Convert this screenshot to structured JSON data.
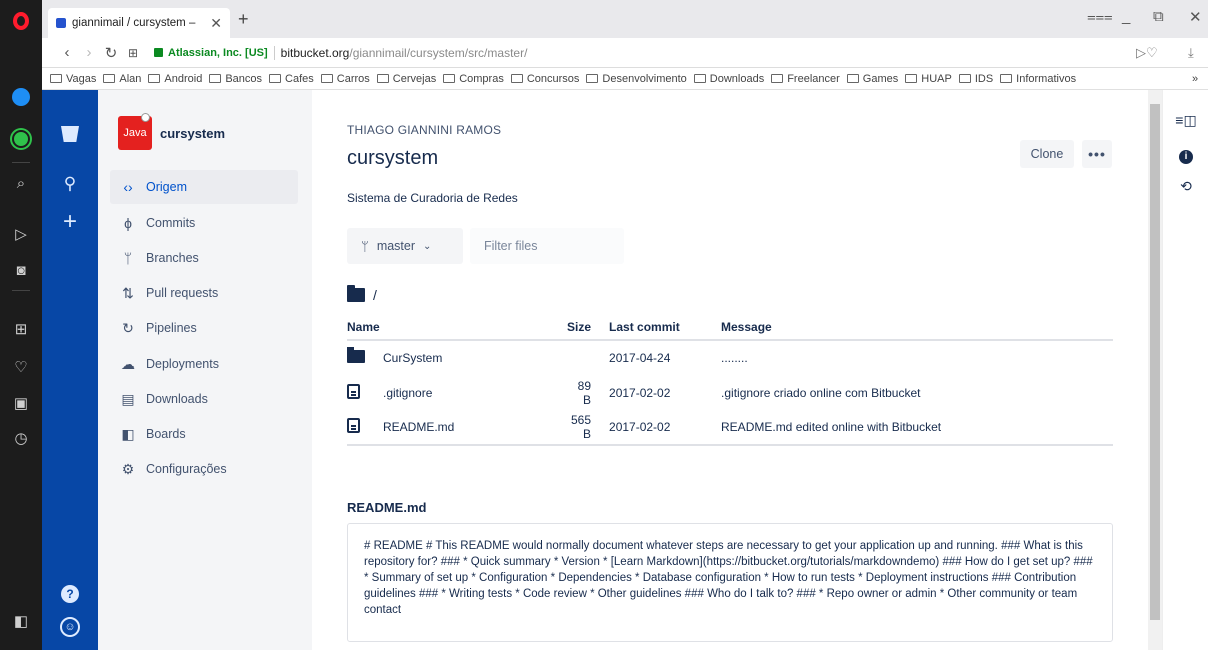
{
  "browser": {
    "tab_title": "giannimail / cursystem –",
    "tab_close": "✕",
    "new_tab": "+",
    "url_cert": "Atlassian, Inc. [US]",
    "url_host": "bitbucket.org",
    "url_path": "/giannimail/cursystem/src/master/",
    "bookmarks": [
      "Vagas",
      "Alan",
      "Android",
      "Bancos",
      "Cafes",
      "Carros",
      "Cervejas",
      "Compras",
      "Concursos",
      "Desenvolvimento",
      "Downloads",
      "Freelancer",
      "Games",
      "HUAP",
      "IDS",
      "Informativos"
    ],
    "bookmarks_more": "»"
  },
  "repo": {
    "logo_text": "Java",
    "name": "cursystem",
    "owner": "THIAGO GIANNINI RAMOS",
    "title": "cursystem",
    "description": "Sistema de Curadoria de Redes",
    "clone_label": "Clone",
    "more_label": "•••"
  },
  "nav": {
    "items": [
      {
        "label": "Origem",
        "icon": "‹›"
      },
      {
        "label": "Commits",
        "icon": "ϕ"
      },
      {
        "label": "Branches",
        "icon": "ᛘ"
      },
      {
        "label": "Pull requests",
        "icon": "⇅"
      },
      {
        "label": "Pipelines",
        "icon": "↻"
      },
      {
        "label": "Deployments",
        "icon": "☁"
      },
      {
        "label": "Downloads",
        "icon": "▤"
      },
      {
        "label": "Boards",
        "icon": "◧"
      },
      {
        "label": "Configurações",
        "icon": "⚙"
      }
    ]
  },
  "source": {
    "branch": "master",
    "filter_placeholder": "Filter files",
    "path": "/",
    "columns": {
      "name": "Name",
      "size": "Size",
      "last_commit": "Last commit",
      "message": "Message"
    },
    "rows": [
      {
        "type": "folder",
        "name": "CurSystem",
        "size": "",
        "date": "2017-04-24",
        "message": "........"
      },
      {
        "type": "file",
        "name": ".gitignore",
        "size": "89 B",
        "date": "2017-02-02",
        "message": ".gitignore criado online com Bitbucket"
      },
      {
        "type": "file",
        "name": "README.md",
        "size": "565 B",
        "date": "2017-02-02",
        "message": "README.md edited online with Bitbucket"
      }
    ]
  },
  "readme": {
    "heading": "README.md",
    "body": "# README # This README would normally document whatever steps are necessary to get your application up and running. ### What is this repository for? ### * Quick summary * Version * [Learn Markdown](https://bitbucket.org/tutorials/markdowndemo) ### How do I get set up? ### * Summary of set up * Configuration * Dependencies * Database configuration * How to run tests * Deployment instructions ### Contribution guidelines ### * Writing tests * Code review * Other guidelines ### Who do I talk to? ### * Repo owner or admin * Other community or team contact"
  }
}
